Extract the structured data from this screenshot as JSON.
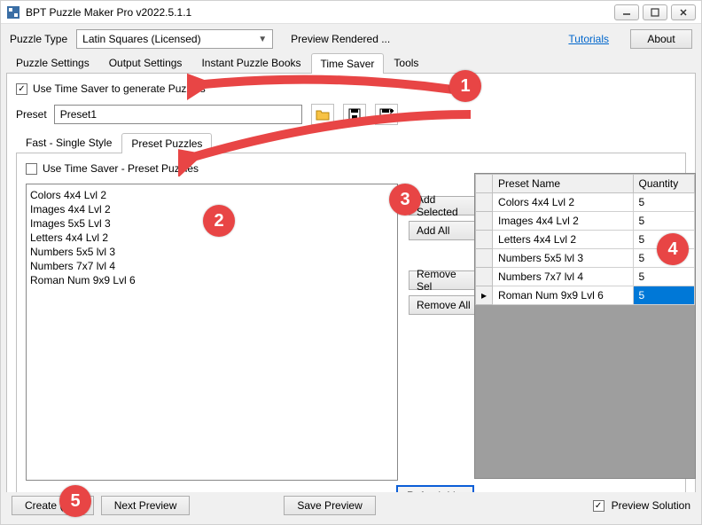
{
  "window": {
    "title": "BPT Puzzle Maker Pro v2022.5.1.1"
  },
  "header": {
    "puzzle_type_label": "Puzzle Type",
    "puzzle_type_value": "Latin Squares (Licensed)",
    "preview_text": "Preview Rendered ...",
    "tutorials": "Tutorials",
    "about": "About"
  },
  "tabs": {
    "puzzle_settings": "Puzzle Settings",
    "output_settings": "Output Settings",
    "instant_books": "Instant Puzzle Books",
    "time_saver": "Time Saver",
    "tools": "Tools"
  },
  "time_saver": {
    "use_generate": "Use Time Saver to generate Puzzles",
    "preset_label": "Preset",
    "preset_value": "Preset1",
    "inner_tabs": {
      "fast": "Fast - Single Style",
      "preset": "Preset Puzzles"
    },
    "use_preset": "Use Time Saver - Preset Puzzles",
    "list": [
      "Colors 4x4 Lvl 2",
      "Images 4x4 Lvl 2",
      "Images 5x5 Lvl 3",
      "Letters 4x4 Lvl 2",
      "Numbers 5x5 lvl 3",
      "Numbers 7x7 lvl 4",
      "Roman Num 9x9 Lvl 6"
    ],
    "btn_add_selected": "Add Selected",
    "btn_add_all": "Add All",
    "btn_remove_sel": "Remove Sel",
    "btn_remove_all": "Remove All",
    "btn_refresh": "Refresh List",
    "table": {
      "col_name": "Preset Name",
      "col_qty": "Quantity",
      "rows": [
        {
          "name": "Colors 4x4 Lvl 2",
          "qty": "5"
        },
        {
          "name": "Images 4x4 Lvl 2",
          "qty": "5"
        },
        {
          "name": "Letters 4x4 Lvl 2",
          "qty": "5"
        },
        {
          "name": "Numbers 5x5 lvl 3",
          "qty": "5"
        },
        {
          "name": "Numbers 7x7 lvl 4",
          "qty": "5"
        },
        {
          "name": "Roman Num 9x9 Lvl 6",
          "qty": "5"
        }
      ]
    }
  },
  "bottom": {
    "create": "Create (TS)",
    "next_preview": "Next Preview",
    "save_preview": "Save Preview",
    "preview_solution": "Preview Solution"
  },
  "callouts": {
    "c1": "1",
    "c2": "2",
    "c3": "3",
    "c4": "4",
    "c5": "5"
  }
}
